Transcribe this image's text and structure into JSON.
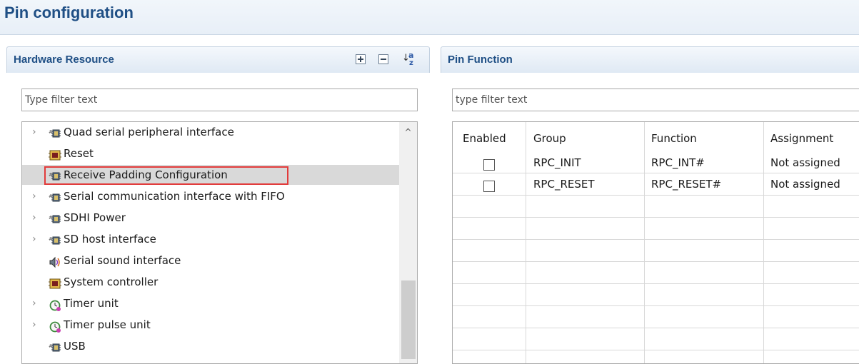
{
  "page": {
    "title": "Pin configuration"
  },
  "hardware_panel": {
    "title": "Hardware Resource",
    "filter_placeholder": "Type filter text",
    "toolbar_icons": [
      "expand-all-icon",
      "collapse-all-icon",
      "sort-alphabetically-icon"
    ],
    "sort_icon_text": {
      "top": "a",
      "bottom": "z",
      "arrow": "↓"
    },
    "items": [
      {
        "label": "Quad serial peripheral interface",
        "expandable": true,
        "icon": "peripheral-chip-icon"
      },
      {
        "label": "Reset",
        "expandable": false,
        "icon": "system-chip-icon"
      },
      {
        "label": "Receive Padding Configuration",
        "expandable": false,
        "icon": "peripheral-chip-icon",
        "selected": true
      },
      {
        "label": "Serial communication interface with FIFO",
        "expandable": true,
        "icon": "peripheral-chip-icon"
      },
      {
        "label": "SDHI Power",
        "expandable": true,
        "icon": "peripheral-chip-icon"
      },
      {
        "label": "SD host interface",
        "expandable": true,
        "icon": "peripheral-chip-icon"
      },
      {
        "label": "Serial sound interface",
        "expandable": false,
        "icon": "speaker-icon"
      },
      {
        "label": "System controller",
        "expandable": false,
        "icon": "system-chip-icon"
      },
      {
        "label": "Timer unit",
        "expandable": true,
        "icon": "timer-icon"
      },
      {
        "label": "Timer pulse unit",
        "expandable": true,
        "icon": "timer-icon"
      },
      {
        "label": "USB",
        "expandable": false,
        "icon": "peripheral-chip-icon"
      }
    ]
  },
  "pin_panel": {
    "title": "Pin Function",
    "filter_placeholder": "type filter text",
    "columns": [
      "Enabled",
      "Group",
      "Function",
      "Assignment"
    ],
    "rows": [
      {
        "enabled": false,
        "group": "RPC_INIT",
        "function": "RPC_INT#",
        "assignment": "Not assigned"
      },
      {
        "enabled": false,
        "group": "RPC_RESET",
        "function": "RPC_RESET#",
        "assignment": "Not assigned"
      }
    ]
  },
  "colors": {
    "title_text": "#1f4f85",
    "selection_highlight": "#d9d9d9",
    "selection_border": "#e23b3b"
  }
}
